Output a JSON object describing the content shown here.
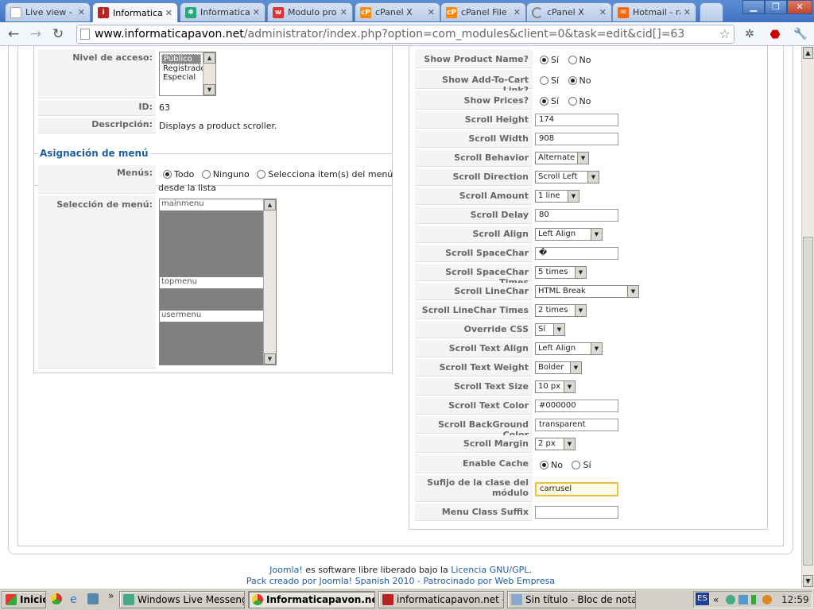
{
  "browser": {
    "tabs": [
      {
        "label": "Live view - A",
        "icon": "page-icon",
        "color": "#9aa"
      },
      {
        "label": "Informatica",
        "icon": "joomla-site-icon",
        "color": "#b22"
      },
      {
        "label": "Informatica",
        "icon": "joomla-icon",
        "color": "#2a7"
      },
      {
        "label": "Modulo prod",
        "icon": "w-icon",
        "color": "#d33"
      },
      {
        "label": "cPanel X",
        "icon": "cpanel-icon",
        "color": "#f80"
      },
      {
        "label": "cPanel File M",
        "icon": "cpanel-icon",
        "color": "#f80"
      },
      {
        "label": "cPanel X",
        "icon": "loading-icon",
        "color": "#888"
      },
      {
        "label": "Hotmail - raf",
        "icon": "hotmail-icon",
        "color": "#f60"
      }
    ],
    "url_domain": "www.informaticapavon.net",
    "url_path": "/administrator/index.php?option=com_modules&client=0&task=edit&cid[]=63"
  },
  "left": {
    "nivel_label": "Nivel de acceso:",
    "nivel_options": [
      "Público",
      "Registrado",
      "Especial"
    ],
    "id_label": "ID:",
    "id_value": "63",
    "desc_label": "Descripción:",
    "desc_value": "Displays a product scroller.",
    "menu_legend": "Asignación de menú",
    "menus_label": "Menús:",
    "menus_options": [
      "Todo",
      "Ninguno",
      "Selecciona item(s) del menú"
    ],
    "menus_options_cont": "desde la lista",
    "seleccion_label": "Selección de menú:",
    "seleccion_items": [
      "mainmenu",
      "topmenu",
      "usermenu"
    ]
  },
  "params": {
    "show_product_name": "Show Product Name?",
    "show_add_to_cart": "Show Add-To-Cart Link?",
    "show_prices": "Show Prices?",
    "yes": "Sí",
    "no": "No",
    "scroll_height": "Scroll Height",
    "scroll_height_v": "174",
    "scroll_width": "Scroll Width",
    "scroll_width_v": "908",
    "scroll_behavior": "Scroll Behavior",
    "scroll_behavior_v": "Alternate",
    "scroll_direction": "Scroll Direction",
    "scroll_direction_v": "Scroll Left",
    "scroll_amount": "Scroll Amount",
    "scroll_amount_v": "1 line",
    "scroll_delay": "Scroll Delay",
    "scroll_delay_v": "80",
    "scroll_align": "Scroll Align",
    "scroll_align_v": "Left Align",
    "scroll_spacechar": "Scroll SpaceChar",
    "scroll_spacechar_v": "�",
    "scroll_spacechar_times": "Scroll SpaceChar Times",
    "scroll_spacechar_times_v": "5 times",
    "scroll_linechar": "Scroll LineChar",
    "scroll_linechar_v": "HTML Break",
    "scroll_linechar_times": "Scroll LineChar Times",
    "scroll_linechar_times_v": "2 times",
    "override_css": "Override CSS",
    "override_css_v": "Sí",
    "scroll_text_align": "Scroll Text Align",
    "scroll_text_align_v": "Left Align",
    "scroll_text_weight": "Scroll Text Weight",
    "scroll_text_weight_v": "Bolder",
    "scroll_text_size": "Scroll Text Size",
    "scroll_text_size_v": "10 px",
    "scroll_text_color": "Scroll Text Color",
    "scroll_text_color_v": "#000000",
    "scroll_bg_color": "Scroll BackGround Color",
    "scroll_bg_color_v": "transparent",
    "scroll_margin": "Scroll Margin",
    "scroll_margin_v": "2 px",
    "enable_cache": "Enable Cache",
    "sufijo_1": "Sufijo de la clase del",
    "sufijo_2": "módulo",
    "sufijo_v": "carrusel",
    "menu_class_suffix": "Menu Class Suffix",
    "menu_class_suffix_v": ""
  },
  "footer": {
    "joomla": "Joomla!",
    "line1_mid": " es software libre liberado bajo la ",
    "license": "Licencia GNU/GPL",
    "dot": ".",
    "line2": "Pack creado por Joomla! Spanish 2010 - Patrocinado por Web Empresa"
  },
  "taskbar": {
    "start": "Inicio",
    "items": [
      "Windows Live Messenger",
      "Informaticapavon.ne...",
      "informaticapavon.net - i...",
      "Sin título - Bloc de notas"
    ],
    "lang": "ES",
    "time": "12:59"
  }
}
